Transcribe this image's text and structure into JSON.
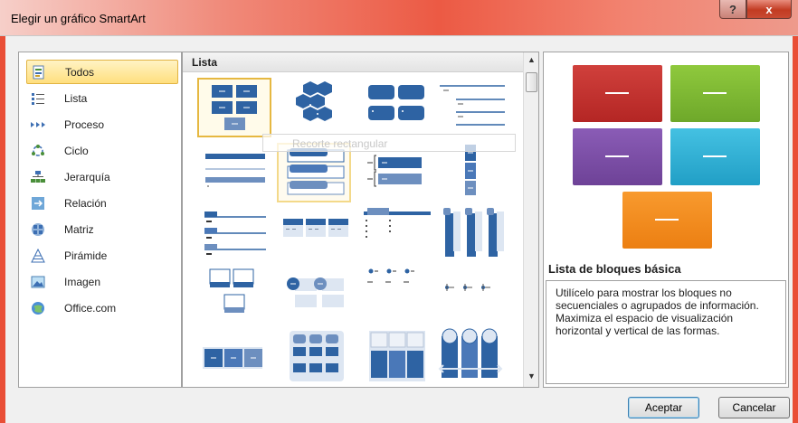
{
  "window": {
    "title": "Elegir un gráfico SmartArt"
  },
  "titlebar": {
    "help_label": "?",
    "close_label": "x"
  },
  "categories": [
    {
      "label": "Todos",
      "icon": "all-icon",
      "selected": true
    },
    {
      "label": "Lista",
      "icon": "list-icon"
    },
    {
      "label": "Proceso",
      "icon": "process-icon"
    },
    {
      "label": "Ciclo",
      "icon": "cycle-icon"
    },
    {
      "label": "Jerarquía",
      "icon": "hierarchy-icon"
    },
    {
      "label": "Relación",
      "icon": "relationship-icon"
    },
    {
      "label": "Matriz",
      "icon": "matrix-icon"
    },
    {
      "label": "Pirámide",
      "icon": "pyramid-icon"
    },
    {
      "label": "Imagen",
      "icon": "picture-icon"
    },
    {
      "label": "Office.com",
      "icon": "office-com-icon"
    }
  ],
  "gallery": {
    "section_header": "Lista",
    "tooltip": "Recorte rectangular",
    "selected_index": 0,
    "hover_index": 5
  },
  "preview": {
    "title": "Lista de bloques básica",
    "description": "Utilícelo para mostrar los bloques no secuenciales o agrupados de información. Maximiza el espacio de visualización horizontal y vertical de las formas.",
    "block_colors": [
      "#c0302d",
      "#7ab833",
      "#7b4ea6",
      "#2fb0d6",
      "#f38a1a"
    ],
    "dash_text": "—"
  },
  "buttons": {
    "ok": "Aceptar",
    "cancel": "Cancelar"
  },
  "colors": {
    "accent_blue": "#2e63a3",
    "light_blue": "#6d8fbf",
    "titlebar_red": "#ec5a44"
  }
}
